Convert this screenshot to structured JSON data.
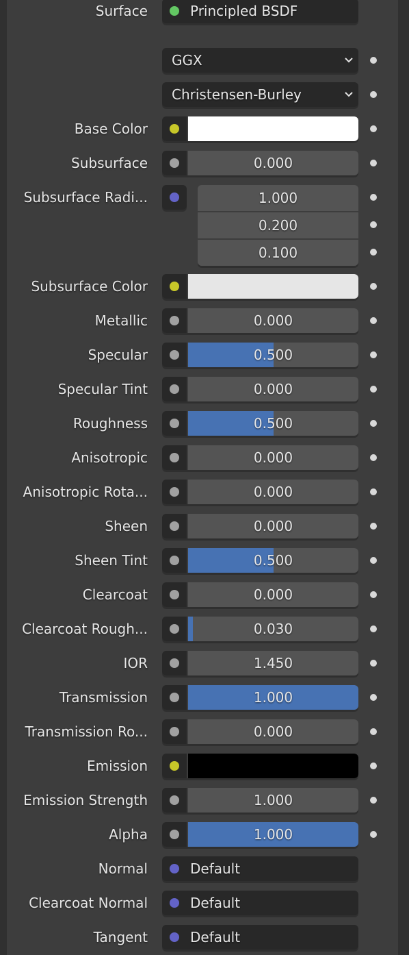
{
  "colors": {
    "socket_shader": "#63c763",
    "socket_color": "#c7c729",
    "socket_float": "#a1a1a1",
    "socket_vector": "#6363c7",
    "slider_fill": "#4772b3"
  },
  "surface": {
    "label": "Surface",
    "value": "Principled BSDF",
    "socket": "shader"
  },
  "distribution": {
    "value": "GGX",
    "icon": "chevron-down-icon"
  },
  "subsurface_method": {
    "value": "Christensen-Burley",
    "icon": "chevron-down-icon"
  },
  "inputs": [
    {
      "key": "base-color",
      "label": "Base Color",
      "type": "color",
      "socket": "color",
      "swatch": "#ffffff"
    },
    {
      "key": "subsurface",
      "label": "Subsurface",
      "type": "float",
      "socket": "float",
      "value": "0.000",
      "fraction": 0
    },
    {
      "key": "subsurface-radius",
      "label": "Subsurface Radi...",
      "type": "vector",
      "socket": "vector",
      "values": [
        "1.000",
        "0.200",
        "0.100"
      ]
    },
    {
      "key": "subsurface-color",
      "label": "Subsurface Color",
      "type": "color",
      "socket": "color",
      "swatch": "#e6e6e6"
    },
    {
      "key": "metallic",
      "label": "Metallic",
      "type": "float",
      "socket": "float",
      "value": "0.000",
      "fraction": 0
    },
    {
      "key": "specular",
      "label": "Specular",
      "type": "float",
      "socket": "float",
      "value": "0.500",
      "fraction": 0.5
    },
    {
      "key": "specular-tint",
      "label": "Specular Tint",
      "type": "float",
      "socket": "float",
      "value": "0.000",
      "fraction": 0
    },
    {
      "key": "roughness",
      "label": "Roughness",
      "type": "float",
      "socket": "float",
      "value": "0.500",
      "fraction": 0.5
    },
    {
      "key": "anisotropic",
      "label": "Anisotropic",
      "type": "float",
      "socket": "float",
      "value": "0.000",
      "fraction": 0
    },
    {
      "key": "anisotropic-rotation",
      "label": "Anisotropic Rota...",
      "type": "float",
      "socket": "float",
      "value": "0.000",
      "fraction": 0
    },
    {
      "key": "sheen",
      "label": "Sheen",
      "type": "float",
      "socket": "float",
      "value": "0.000",
      "fraction": 0
    },
    {
      "key": "sheen-tint",
      "label": "Sheen Tint",
      "type": "float",
      "socket": "float",
      "value": "0.500",
      "fraction": 0.5
    },
    {
      "key": "clearcoat",
      "label": "Clearcoat",
      "type": "float",
      "socket": "float",
      "value": "0.000",
      "fraction": 0
    },
    {
      "key": "clearcoat-roughness",
      "label": "Clearcoat Rough...",
      "type": "float",
      "socket": "float",
      "value": "0.030",
      "fraction": 0.03
    },
    {
      "key": "ior",
      "label": "IOR",
      "type": "float",
      "socket": "float",
      "value": "1.450",
      "fraction": 0
    },
    {
      "key": "transmission",
      "label": "Transmission",
      "type": "float",
      "socket": "float",
      "value": "1.000",
      "fraction": 1
    },
    {
      "key": "transmission-roughness",
      "label": "Transmission Ro...",
      "type": "float",
      "socket": "float",
      "value": "0.000",
      "fraction": 0
    },
    {
      "key": "emission",
      "label": "Emission",
      "type": "color",
      "socket": "color",
      "swatch": "#000000"
    },
    {
      "key": "emission-strength",
      "label": "Emission Strength",
      "type": "float",
      "socket": "float",
      "value": "1.000",
      "fraction": 0
    },
    {
      "key": "alpha",
      "label": "Alpha",
      "type": "float",
      "socket": "float",
      "value": "1.000",
      "fraction": 1
    },
    {
      "key": "normal",
      "label": "Normal",
      "type": "link",
      "socket": "vector",
      "value": "Default"
    },
    {
      "key": "clearcoat-normal",
      "label": "Clearcoat Normal",
      "type": "link",
      "socket": "vector",
      "value": "Default"
    },
    {
      "key": "tangent",
      "label": "Tangent",
      "type": "link",
      "socket": "vector",
      "value": "Default"
    }
  ]
}
